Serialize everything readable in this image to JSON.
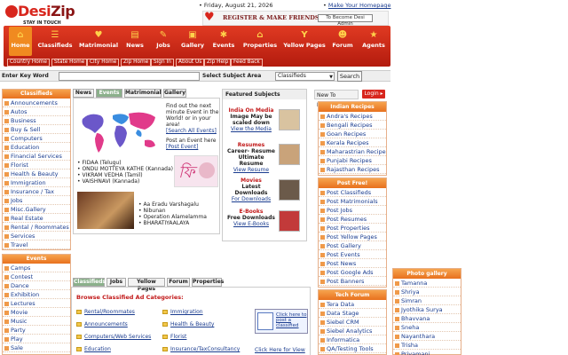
{
  "header": {
    "logo_main": "Desi",
    "logo_accent": "Zip",
    "logo_tagline": "STAY IN TOUCH",
    "date": "Friday, August 21, 2026",
    "make_homepage": "Make Your Homepage",
    "register_text": "REGISTER & MAKE FRIENDS",
    "become_admin": "To Become Desi Admin"
  },
  "nav": {
    "items": [
      {
        "label": "Home",
        "icon": "home-icon"
      },
      {
        "label": "Classifieds",
        "icon": "classifieds-icon"
      },
      {
        "label": "Matrimonial",
        "icon": "matrimonial-icon"
      },
      {
        "label": "News",
        "icon": "news-icon"
      },
      {
        "label": "Jobs",
        "icon": "jobs-icon"
      },
      {
        "label": "Gallery",
        "icon": "gallery-icon"
      },
      {
        "label": "Events",
        "icon": "events-icon"
      },
      {
        "label": "Properties",
        "icon": "properties-icon"
      },
      {
        "label": "Yellow Pages",
        "icon": "yellow-pages-icon"
      },
      {
        "label": "Forum",
        "icon": "forum-icon"
      },
      {
        "label": "Agents",
        "icon": "agents-icon"
      }
    ],
    "sub": [
      "Country Home",
      "State Home",
      "City Home",
      "Zip Home",
      "Sign In",
      "About Us",
      "Zip Help",
      "Feed Back"
    ]
  },
  "search": {
    "keyword_label": "Enter Key Word",
    "keyword_value": "",
    "area_label": "Select Subject Area",
    "area_selected": "Classifieds",
    "button": "Search"
  },
  "left": {
    "classifieds_title": "Classifieds",
    "classifieds": [
      "Announcements",
      "Autos",
      "Business",
      "Buy & Sell",
      "Computers",
      "Education",
      "Financial Services",
      "Florist",
      "Health & Beauty",
      "Immigration",
      "Insurance / Tax",
      "Jobs",
      "Misc.Gallery",
      "Real Estate",
      "Rental / Roommates",
      "Services",
      "Travel"
    ],
    "events_title": "Events",
    "events": [
      "Camps",
      "Contest",
      "Dance",
      "Exhibition",
      "Lectures",
      "Movie",
      "Music",
      "Party",
      "Play",
      "Sale"
    ]
  },
  "center": {
    "tabs": [
      "News",
      "Events",
      "Matrimonial",
      "Gallery"
    ],
    "event_blurb": "Find out the next minute Event in the World! or in your area!",
    "search_all": "[Search All Events]",
    "post_blurb": "Post an Event here",
    "post_link": "[Post Event]",
    "events1": [
      "FIDAA (Telugu)",
      "ONDU MOTTEYA KATHE (Kannada)",
      "VIKRAM VEDHA (Tamil)",
      "VAISHNAVI (Kannada)"
    ],
    "events2": [
      "Aa Eradu Varshagalu",
      "Nibunan",
      "Operation Alamelamma",
      "BHARATIYAALAYA"
    ],
    "featured_title": "Featured Subjects",
    "featured": [
      {
        "title": "India On Media",
        "body": "Image May be scaled down",
        "link": "View the Media"
      },
      {
        "title": "Resumes",
        "body": "Career- Resume Ultimate Resume",
        "link": "View Resume"
      },
      {
        "title": "Movies",
        "body": "Latest Downloads",
        "link": "For Downloads"
      },
      {
        "title": "E-Books",
        "body": "Free Downloads",
        "link": "View E-Books"
      }
    ],
    "bottom_tabs": [
      "Classifieds",
      "Jobs",
      "Yellow Pages",
      "Forum",
      "Properties"
    ],
    "browse_title": "Browse Classified Ad Categories:",
    "browse_left": [
      "Rental/Roommates",
      "Announcements",
      "Computers/Web Services",
      "Education"
    ],
    "browse_right": [
      "Immigration",
      "Health & Beauty",
      "Florist",
      "Insurance/TaxConsultancy"
    ],
    "post_classified": "Click here to post a classified",
    "click_view": "Click Here for View"
  },
  "right": {
    "new_to": "New To Desizip?",
    "login": "Login",
    "recipes_title": "Indian Recipes",
    "recipes": [
      "Andra's Recipes",
      "Bengali Recipes",
      "Goan Recipes",
      "Kerala Recipes",
      "Maharastrian Recipes",
      "Punjabi Recipes",
      "Rajasthan Recipes"
    ],
    "postfree_title": "Post Free!",
    "postfree": [
      "Post Classifieds",
      "Post Matrimonials",
      "Post Jobs",
      "Post Resumes",
      "Post Properties",
      "Post Yellow Pages",
      "Post Gallery",
      "Post Events",
      "Post News",
      "Post Google Ads",
      "Post Banners"
    ],
    "tech_title": "Tech Forum",
    "tech": [
      "Tera Data",
      "Data Stage",
      "Siebel CRM",
      "Siebel Analytics",
      "Informatica",
      "QA/Testing Tools"
    ],
    "photo_title": "Photo gallery",
    "photos": [
      "Tamanna",
      "Shriya",
      "Simran",
      "Jyothika Surya",
      "Bhavvana",
      "Sneha",
      "Nayanthara",
      "Trisha",
      "Priyamani"
    ]
  },
  "colors": {
    "brand_red": "#d8261d",
    "nav_orange": "#f08a20",
    "link_blue": "#1a3c8f"
  }
}
